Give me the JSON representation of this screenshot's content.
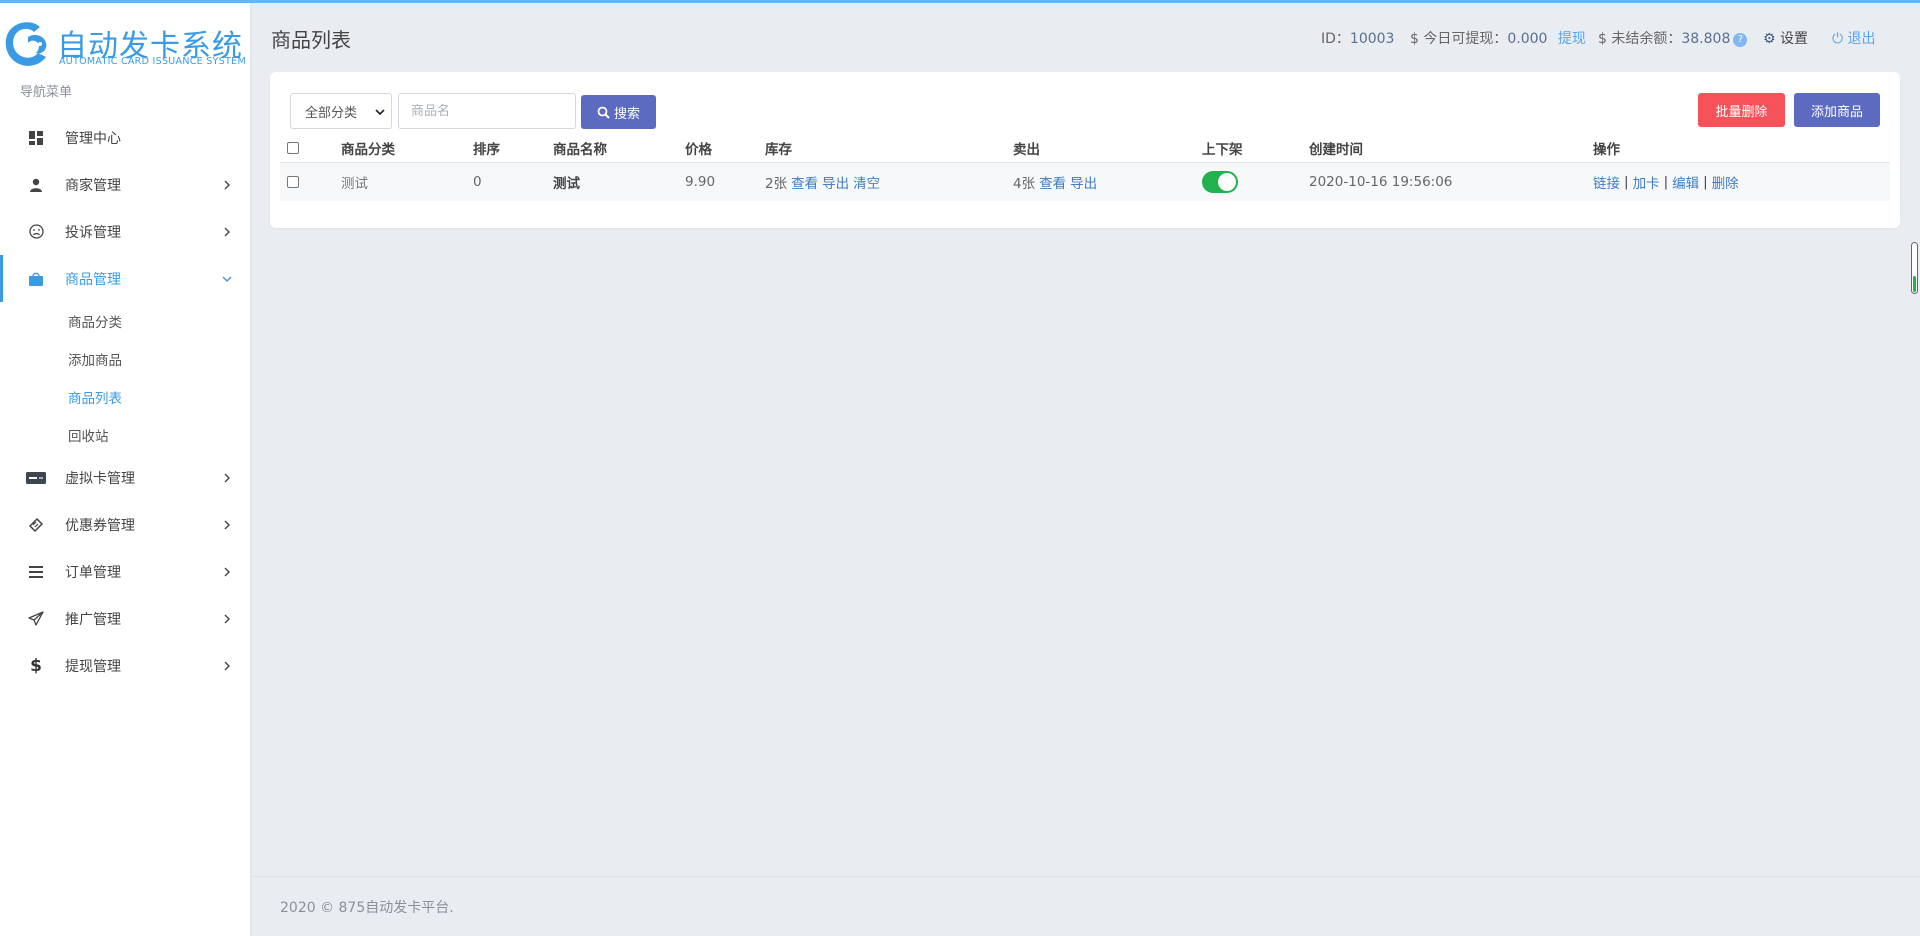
{
  "brand": {
    "title": "自动发卡系统",
    "subtitle": "AUTOMATIC CARD ISSUANCE SYSTEM",
    "color": "#3a9be4"
  },
  "sidebar": {
    "caption": "导航菜单",
    "items": [
      {
        "label": "管理中心",
        "icon": "dashboard-icon"
      },
      {
        "label": "商家管理",
        "icon": "user-icon"
      },
      {
        "label": "投诉管理",
        "icon": "sad-face-icon"
      },
      {
        "label": "商品管理",
        "icon": "shopping-bag-icon",
        "active": true
      },
      {
        "label": "虚拟卡管理",
        "icon": "card-icon"
      },
      {
        "label": "优惠券管理",
        "icon": "ticket-icon"
      },
      {
        "label": "订单管理",
        "icon": "list-icon"
      },
      {
        "label": "推广管理",
        "icon": "paper-plane-icon"
      },
      {
        "label": "提现管理",
        "icon": "dollar-icon"
      }
    ],
    "sub_items": [
      {
        "label": "商品分类"
      },
      {
        "label": "添加商品"
      },
      {
        "label": "商品列表",
        "active": true
      },
      {
        "label": "回收站"
      }
    ]
  },
  "header": {
    "page_title": "商品列表",
    "id_label": "ID：",
    "id_value": "10003",
    "withdrawable_label": "$ 今日可提现：",
    "withdrawable_value": "0.000",
    "withdraw_link": "提现",
    "balance_label": "$ 未结余额：",
    "balance_value": "38.808",
    "help_badge": "?",
    "settings": "设置",
    "logout": "退出"
  },
  "filter": {
    "category_selected": "全部分类",
    "name_placeholder": "商品名",
    "search_button": "搜索",
    "batch_delete_button": "批量删除",
    "add_button": "添加商品"
  },
  "table": {
    "columns": [
      "商品分类",
      "排序",
      "商品名称",
      "价格",
      "库存",
      "卖出",
      "上下架",
      "创建时间",
      "操作"
    ],
    "rows": [
      {
        "category": "测试",
        "sort": "0",
        "name": "测试",
        "price": "9.90",
        "stock": "2张",
        "stock_view": "查看",
        "stock_export": "导出",
        "stock_clear": "清空",
        "sold": "4张",
        "sold_view": "查看",
        "sold_export": "导出",
        "on_shelf": true,
        "created": "2020-10-16 19:56:06",
        "actions": [
          "链接",
          "加卡",
          "编辑",
          "删除"
        ]
      }
    ]
  },
  "footer": {
    "text": "2020 © 875自动发卡平台."
  },
  "colors": {
    "primary": "#5c6bc0",
    "danger": "#f7525a",
    "toggle_on": "#23b14d",
    "link": "#3f7dc4"
  }
}
